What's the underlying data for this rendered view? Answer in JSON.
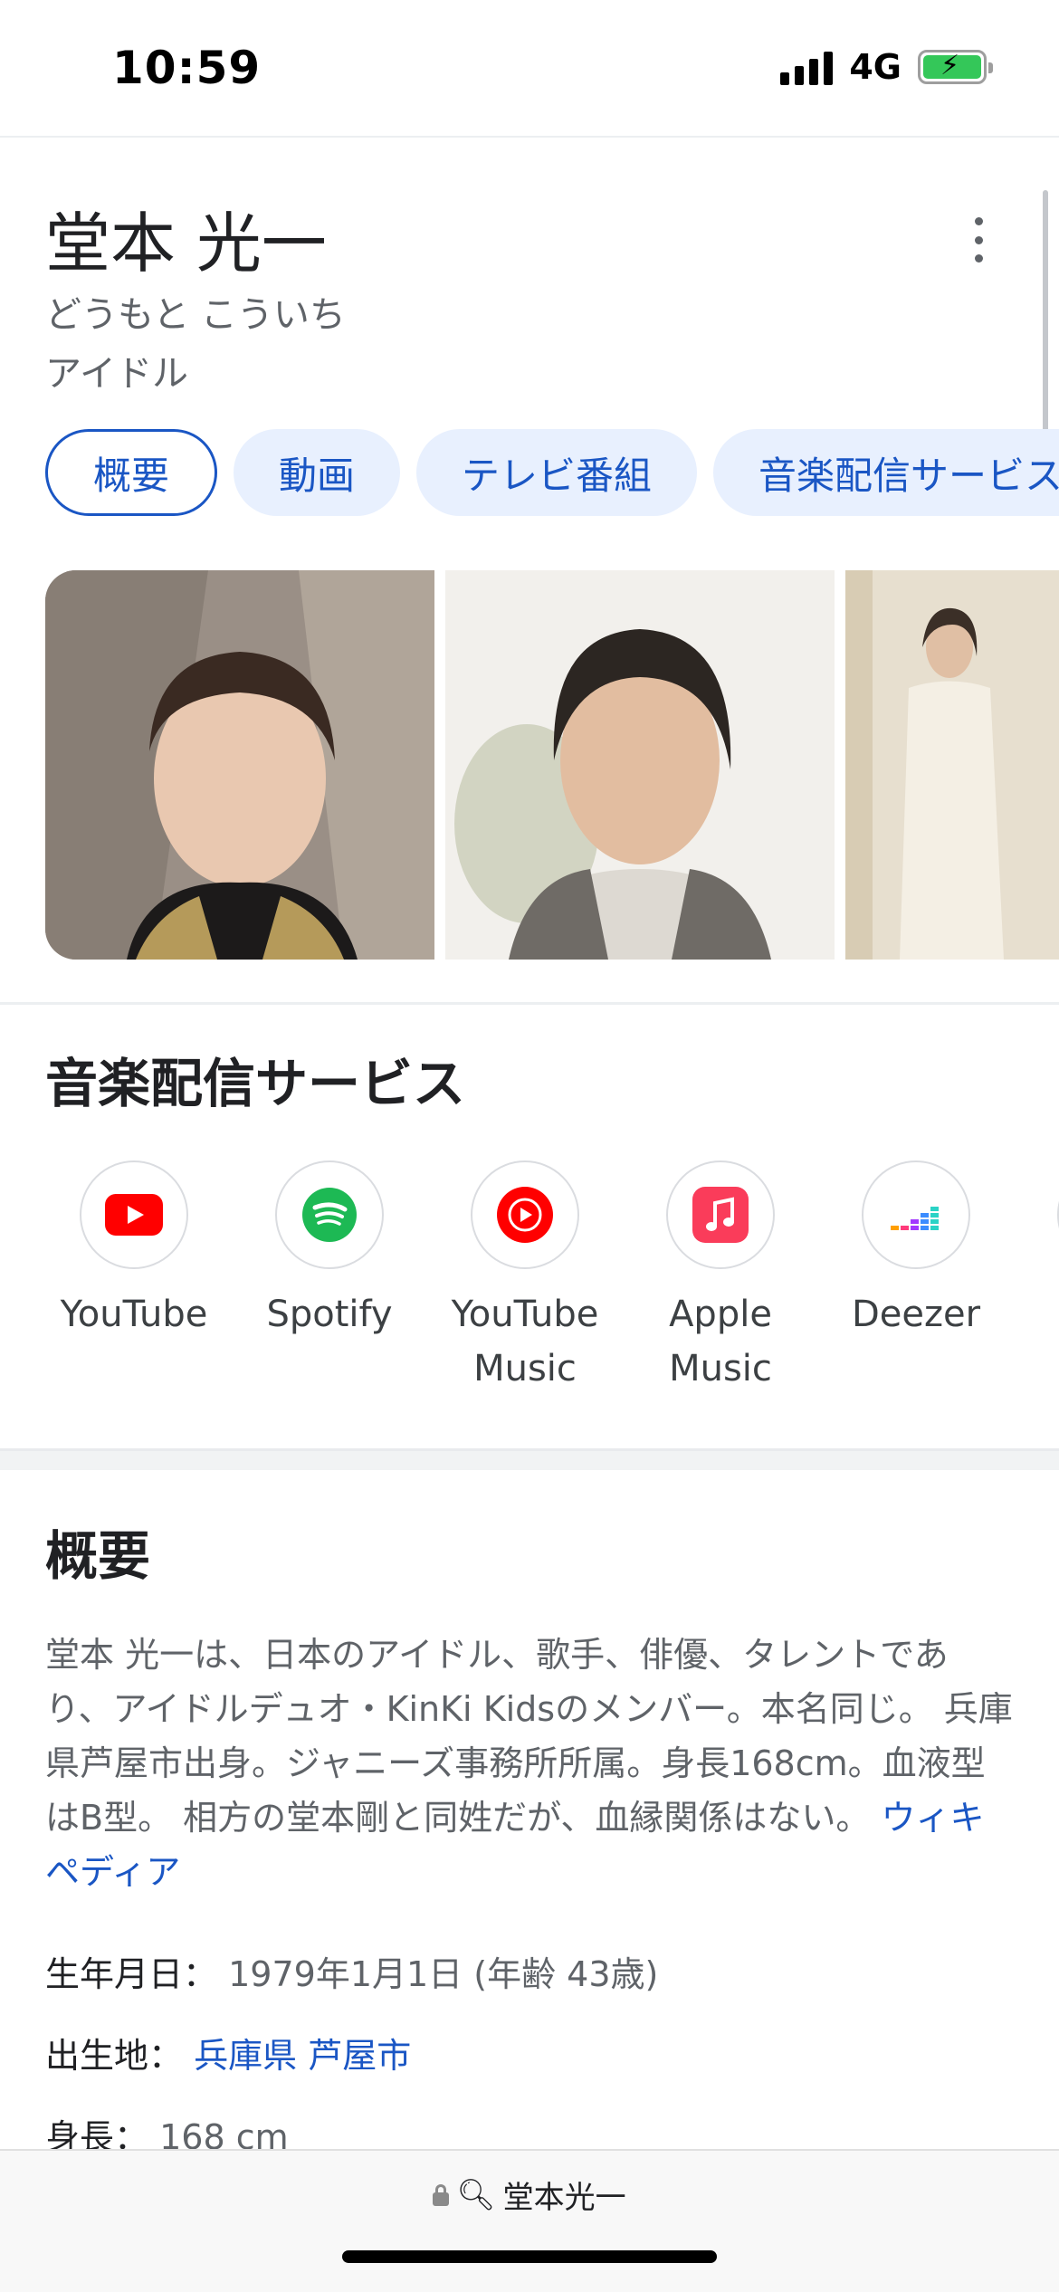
{
  "status_bar": {
    "time": "10:59",
    "network": "4G",
    "battery_charging": true
  },
  "knowledge_panel": {
    "title": "堂本 光一",
    "reading": "どうもと こういち",
    "type": "アイドル",
    "chips": [
      "概要",
      "動画",
      "テレビ番組",
      "音楽配信サービス"
    ],
    "active_chip": "概要"
  },
  "music_services": {
    "title": "音楽配信サービス",
    "items": [
      {
        "label_line1": "YouTube",
        "label_line2": "",
        "icon": "youtube-icon",
        "color": "#ff0000"
      },
      {
        "label_line1": "Spotify",
        "label_line2": "",
        "icon": "spotify-icon",
        "color": "#1db954"
      },
      {
        "label_line1": "YouTube",
        "label_line2": "Music",
        "icon": "youtube-music-icon",
        "color": "#ff0000"
      },
      {
        "label_line1": "Apple",
        "label_line2": "Music",
        "icon": "apple-music-icon",
        "color": "#fa3c5a"
      },
      {
        "label_line1": "Deezer",
        "label_line2": "",
        "icon": "deezer-icon",
        "color": "#a238ff"
      }
    ]
  },
  "overview": {
    "title": "概要",
    "description": "堂本 光一は、日本のアイドル、歌手、俳優、タレントであり、アイドルデュオ・KinKi Kidsのメンバー。本名同じ。 兵庫県芦屋市出身。ジャニーズ事務所所属。身長168cm。血液型はB型。 相方の堂本剛と同姓だが、血縁関係はない。",
    "source_link": "ウィキペディア",
    "facts": {
      "birth_label": "生年月日：",
      "birth_value": "1979年1月1日 (年齢 43歳)",
      "birthplace_label": "出生地：",
      "birthplace_value": "兵庫県 芦屋市",
      "height_label": "身長：",
      "height_value": "168 cm"
    }
  },
  "bottom_bar": {
    "url_text": "堂本光一"
  },
  "colors": {
    "link": "#1a56c4",
    "chip_bg": "#e8f0fe",
    "text_secondary": "#5f6368"
  }
}
